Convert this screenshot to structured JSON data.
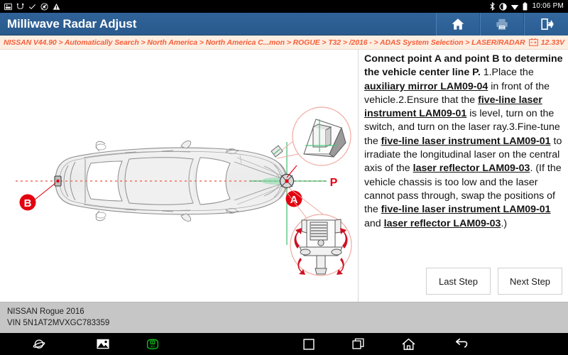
{
  "statusbar": {
    "left_icons": [
      "screenshot-icon",
      "usb-debug-icon",
      "check-icon",
      "no-sound-icon",
      "warning-icon"
    ],
    "right_icons": [
      "bluetooth-icon",
      "brightness-icon",
      "wifi-icon",
      "battery-icon"
    ],
    "time": "10:06 PM"
  },
  "header": {
    "title": "Milliwave Radar Adjust",
    "buttons": [
      {
        "name": "home-button",
        "icon": "home-icon"
      },
      {
        "name": "print-button",
        "icon": "printer-icon"
      },
      {
        "name": "exit-button",
        "icon": "exit-icon"
      }
    ]
  },
  "breadcrumb": {
    "path": "NISSAN V44.90 > Automatically Search > North America > North America C...mon > ROGUE > T32 > /2016 - > ADAS System Selection > LASER/RADAR",
    "battery_icon": "battery-voltage-icon",
    "voltage": "12.33V"
  },
  "diagram": {
    "point_a_label": "A",
    "point_b_label": "B",
    "center_line_label": "P",
    "callout_top": "auxiliary-mirror-detail",
    "callout_bottom": "laser-instrument-detail"
  },
  "instructions": {
    "heading": "Connect point A and point B to determine the vehicle center line P.",
    "body_segments": [
      {
        "text": "1.Place the ",
        "style": "normal"
      },
      {
        "text": "auxiliary mirror LAM09-04",
        "style": "tool"
      },
      {
        "text": " in front of the vehicle.2.Ensure that the ",
        "style": "normal"
      },
      {
        "text": "five-line laser instrument LAM09-01",
        "style": "tool"
      },
      {
        "text": " is level, turn on the switch, and turn on the laser ray.3.Fine-tune the ",
        "style": "normal"
      },
      {
        "text": "five-line laser instrument LAM09-01",
        "style": "tool"
      },
      {
        "text": " to irradiate the longitudinal laser on the central axis of the ",
        "style": "normal"
      },
      {
        "text": "laser reflector LAM09-03",
        "style": "tool"
      },
      {
        "text": ". (If the vehicle chassis is too low and the laser cannot pass through, swap the positions of the ",
        "style": "normal"
      },
      {
        "text": "five-line laser instrument LAM09-01",
        "style": "tool"
      },
      {
        "text": " and ",
        "style": "normal"
      },
      {
        "text": "laser reflector LAM09-03",
        "style": "tool"
      },
      {
        "text": ".)",
        "style": "normal"
      }
    ]
  },
  "buttons": {
    "last_step": "Last Step",
    "next_step": "Next Step"
  },
  "vehicle_info": {
    "model": "NISSAN Rogue 2016",
    "vin": "VIN 5N1AT2MVXGC783359"
  },
  "navbar": {
    "items": [
      {
        "name": "nav-browser-icon",
        "icon": "planet-icon"
      },
      {
        "name": "nav-gallery-icon",
        "icon": "image-icon"
      },
      {
        "name": "nav-vci-icon",
        "icon": "vci-icon"
      },
      {
        "name": "nav-square-icon",
        "icon": "square-icon"
      },
      {
        "name": "nav-recents-icon",
        "icon": "recents-icon"
      },
      {
        "name": "nav-home-icon",
        "icon": "home-icon"
      },
      {
        "name": "nav-back-icon",
        "icon": "back-icon"
      }
    ]
  },
  "colors": {
    "header_blue": "#2b5d92",
    "breadcrumb_bg": "#fdeee2",
    "breadcrumb_text": "#f4603c",
    "marker_red": "#e3000f",
    "vci_green": "#13b21a",
    "info_bar": "#c6c6c6"
  }
}
